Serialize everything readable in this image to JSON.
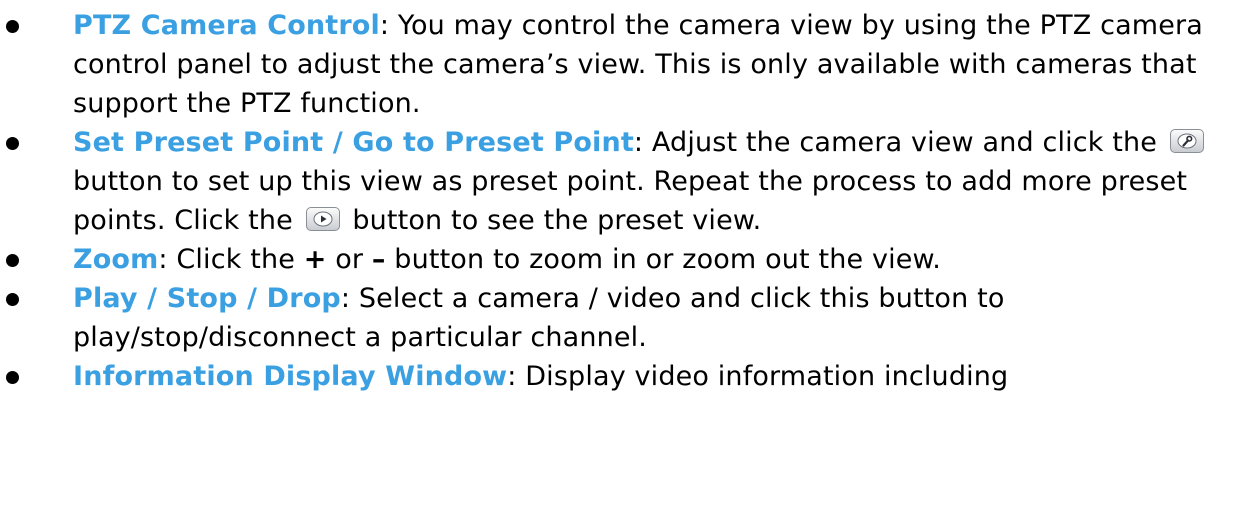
{
  "items": [
    {
      "term": "PTZ Camera Control",
      "text": ": You may control the camera view by using the PTZ camera control panel to adjust the camera’s view. This is only available with cameras that support the PTZ function."
    },
    {
      "term": "Set Preset Point / Go to Preset Point",
      "text_a": ": Adjust the camera view and click the",
      "icon_a": "wrench-icon",
      "text_b": "button to set up this view as preset point. Repeat the process to add more preset points. Click the",
      "icon_b": "play-icon",
      "text_c": "button to see the preset view."
    },
    {
      "term": "Zoom",
      "text_a": ": Click the",
      "plus": "+",
      "text_b": "or",
      "minus": "–",
      "text_c": "button to zoom in or zoom out the view."
    },
    {
      "term": "Play / Stop / Drop",
      "text": ": Select a camera / video and click this button to play/stop/disconnect a particular channel."
    },
    {
      "term": "Information Display Window",
      "text": ": Display video information including"
    }
  ],
  "colors": {
    "term": "#3aa0e2",
    "text": "#000000",
    "bullet": "#000000"
  }
}
